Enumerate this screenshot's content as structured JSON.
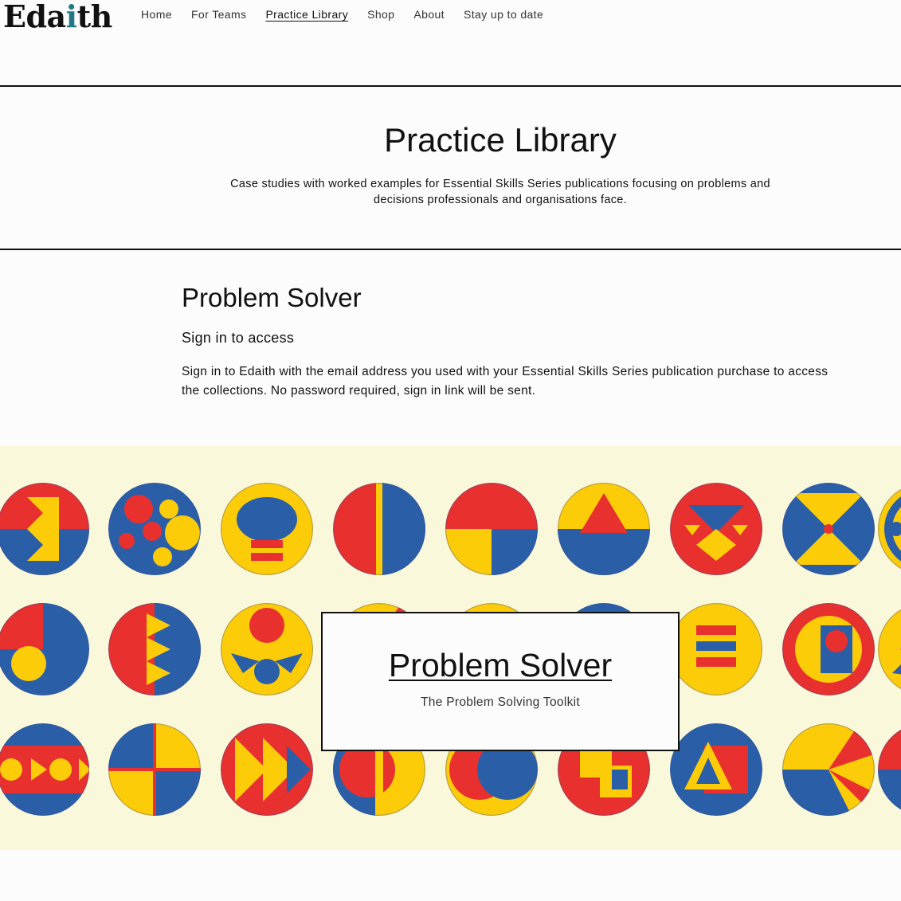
{
  "header": {
    "logo_prefix": "Eda",
    "logo_accent": "i",
    "logo_suffix": "th",
    "nav": [
      "Home",
      "For Teams",
      "Practice Library",
      "Shop",
      "About",
      "Stay up to date"
    ],
    "active_nav": "Practice Library"
  },
  "hero": {
    "title": "Practice Library",
    "description": "Case studies with worked examples for Essential Skills Series publications focusing on problems and decisions professionals and organisations face."
  },
  "section": {
    "title": "Problem Solver",
    "subtitle": "Sign in to access",
    "body": "Sign in to Edaith with the email address you used with your Essential Skills Series publication purchase to access the collections. No password required, sign in link will be sent."
  },
  "card": {
    "title": "Problem Solver",
    "subtitle": "The Problem Solving Toolkit"
  },
  "colors": {
    "red": "#e8302f",
    "blue": "#2a5fa8",
    "yellow": "#fdcc09",
    "pattern_bg": "#faf8da",
    "logo_accent": "#1f7a86"
  }
}
